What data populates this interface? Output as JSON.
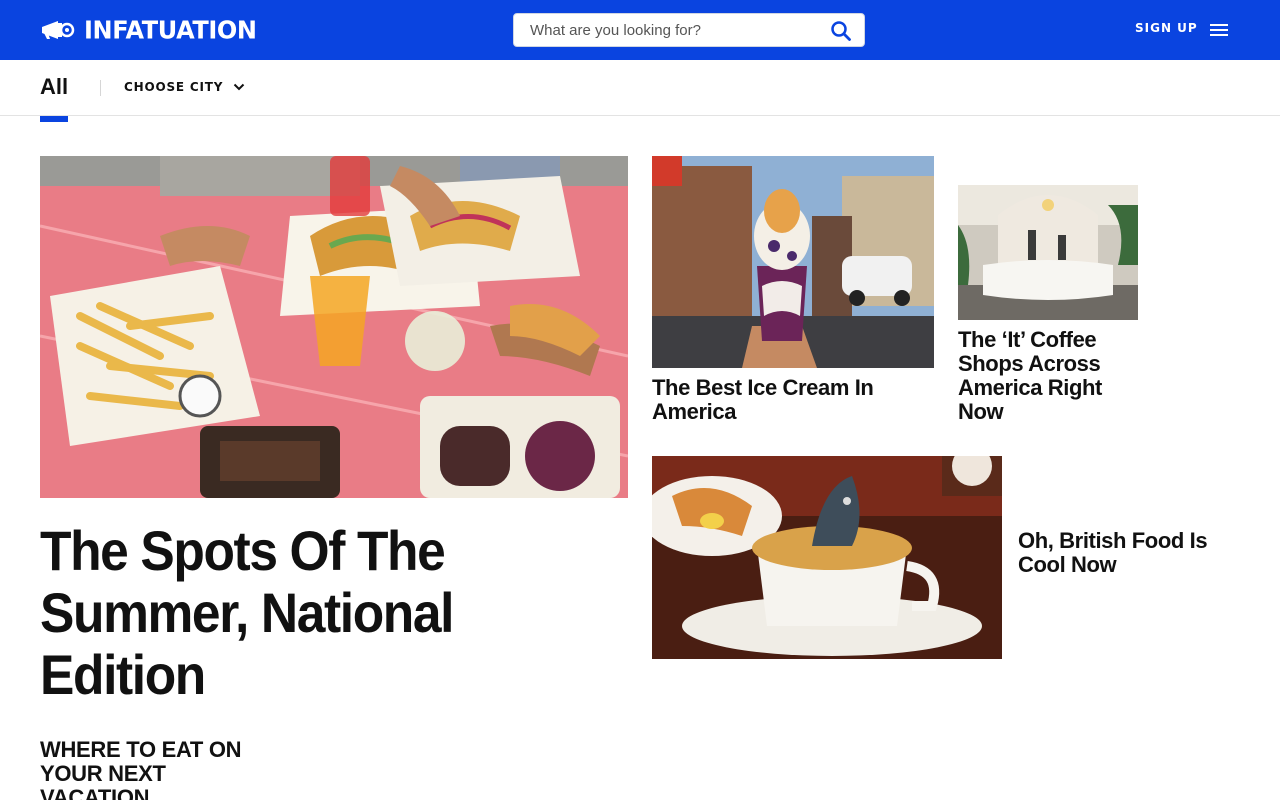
{
  "header": {
    "brand": "INFATUATION",
    "search_placeholder": "What are you looking for?",
    "signup_label": "SIGN UP",
    "logo_icon": "megaphone-icon",
    "search_icon": "search-icon",
    "menu_icon": "hamburger-menu-icon",
    "brand_color": "#0a44e0"
  },
  "subnav": {
    "active_tab": "All",
    "city_selector_label": "CHOOSE CITY",
    "city_selector_icon": "chevron-down-icon"
  },
  "features": {
    "hero": {
      "title": "The Spots Of The Summer, National Edition"
    },
    "ice_cream": {
      "title": "The Best Ice Cream In America"
    },
    "coffee": {
      "title": "The ‘It’ Coffee Shops Across America Right Now"
    },
    "british": {
      "title": "Oh, British Food Is Cool Now"
    }
  },
  "sections": {
    "vacation_heading": "WHERE TO EAT ON YOUR NEXT VACATION"
  }
}
